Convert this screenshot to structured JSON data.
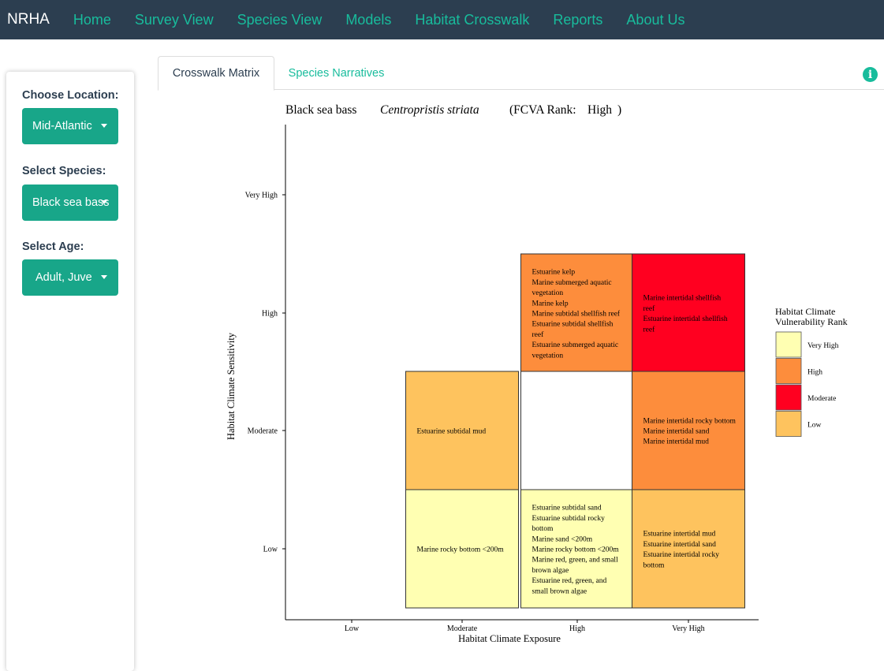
{
  "navbar": {
    "brand": "NRHA",
    "links": [
      "Home",
      "Survey View",
      "Species View",
      "Models",
      "Habitat Crosswalk",
      "Reports",
      "About Us"
    ]
  },
  "sidebar": {
    "location_label": "Choose Location:",
    "location_value": "Mid-Atlantic",
    "species_label": "Select Species:",
    "species_value": "Black sea bass",
    "age_label": "Select Age:",
    "age_value": "Adult, Juve"
  },
  "tabs": [
    "Crosswalk Matrix",
    "Species Narratives"
  ],
  "icons": {
    "info": "info-icon",
    "dropdown": "caret-down-icon"
  },
  "colors": {
    "navbar": "#2c3e50",
    "accent": "#18bc9c",
    "select": "#18a689",
    "very_high": "#ffffb2",
    "high": "#fd8d3c",
    "moderate": "#ff0020",
    "low": "#fec35e"
  },
  "chart_data": {
    "type": "heatmap",
    "title": {
      "common_name": "Black sea bass",
      "scientific_name": "Centropristis striata",
      "rank_prefix": "(FCVA Rank:",
      "rank_value": "High",
      "rank_suffix": ")"
    },
    "xlabel": "Habitat Climate Exposure",
    "ylabel": "Habitat Climate Sensitivity",
    "x_categories": [
      "Low",
      "Moderate",
      "High",
      "Very High"
    ],
    "y_categories": [
      "Low",
      "Moderate",
      "High",
      "Very High"
    ],
    "legend": {
      "title_lines": [
        "Habitat Climate",
        "Vulnerability Rank"
      ],
      "position": "right",
      "items": [
        {
          "label": "Very High",
          "color": "#ffffb2"
        },
        {
          "label": "High",
          "color": "#fd8d3c"
        },
        {
          "label": "Moderate",
          "color": "#ff0020"
        },
        {
          "label": "Low",
          "color": "#fec35e"
        }
      ]
    },
    "cells": [
      {
        "x": "High",
        "y": "High",
        "rank": "High",
        "lines": [
          "Estuarine kelp",
          "Marine submerged aquatic",
          "vegetation",
          "Marine kelp",
          "Marine subtidal shellfish reef",
          "Estuarine subtidal shellfish",
          "reef",
          "Estuarine submerged aquatic",
          "vegetation"
        ]
      },
      {
        "x": "Very High",
        "y": "High",
        "rank": "Moderate",
        "lines": [
          "Marine intertidal shellfish",
          "reef",
          "Estuarine intertidal shellfish",
          "reef"
        ]
      },
      {
        "x": "Moderate",
        "y": "Moderate",
        "rank": "Low",
        "lines": [
          "Estuarine subtidal mud"
        ]
      },
      {
        "x": "High",
        "y": "Moderate",
        "rank": "None",
        "lines": []
      },
      {
        "x": "Very High",
        "y": "Moderate",
        "rank": "High",
        "lines": [
          "Marine intertidal rocky bottom",
          "Marine intertidal sand",
          "Marine intertidal mud"
        ]
      },
      {
        "x": "Moderate",
        "y": "Low",
        "rank": "Very High",
        "lines": [
          "Marine rocky bottom <200m"
        ]
      },
      {
        "x": "High",
        "y": "Low",
        "rank": "Very High",
        "lines": [
          "Estuarine subtidal sand",
          "Estuarine subtidal rocky",
          "bottom",
          "Marine sand <200m",
          "Marine rocky bottom <200m",
          "Marine red, green, and small",
          "brown algae",
          "Estuarine red, green, and",
          "small brown algae"
        ]
      },
      {
        "x": "Very High",
        "y": "Low",
        "rank": "Low",
        "lines": [
          "Estuarine intertidal mud",
          "Estuarine intertidal sand",
          "Estuarine intertidal rocky",
          "bottom"
        ]
      }
    ]
  }
}
